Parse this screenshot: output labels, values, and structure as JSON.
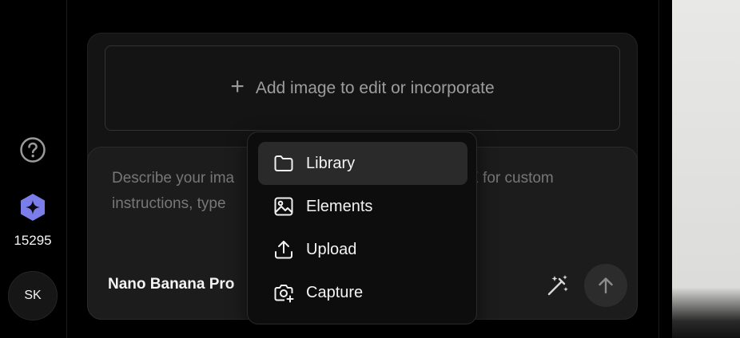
{
  "sidebar": {
    "credits_count": "15295",
    "avatar_initials": "SK",
    "help_icon": "question-circle-icon",
    "credits_icon": "sparkle-hexagon-icon"
  },
  "composer": {
    "dropzone_label": "Add image to edit or incorporate",
    "prompt_placeholder": "Describe your image. Use X for custom instructions, type",
    "prompt_visible_left_1": "Describe your ima",
    "prompt_visible_right_1": "X for custom",
    "prompt_visible_left_2": "instructions, type",
    "model_label": "Nano Banana Pro",
    "magic_icon": "magic-wand-icon",
    "send_icon": "arrow-up-icon"
  },
  "menu": {
    "items": [
      {
        "label": "Library",
        "icon": "folder-icon",
        "active": true
      },
      {
        "label": "Elements",
        "icon": "image-icon",
        "active": false
      },
      {
        "label": "Upload",
        "icon": "upload-icon",
        "active": false
      },
      {
        "label": "Capture",
        "icon": "camera-plus-icon",
        "active": false
      }
    ]
  },
  "colors": {
    "accent_credits": "#7b7ee8",
    "background": "#000000",
    "card": "#141414",
    "menu": "#0d0d0d"
  }
}
